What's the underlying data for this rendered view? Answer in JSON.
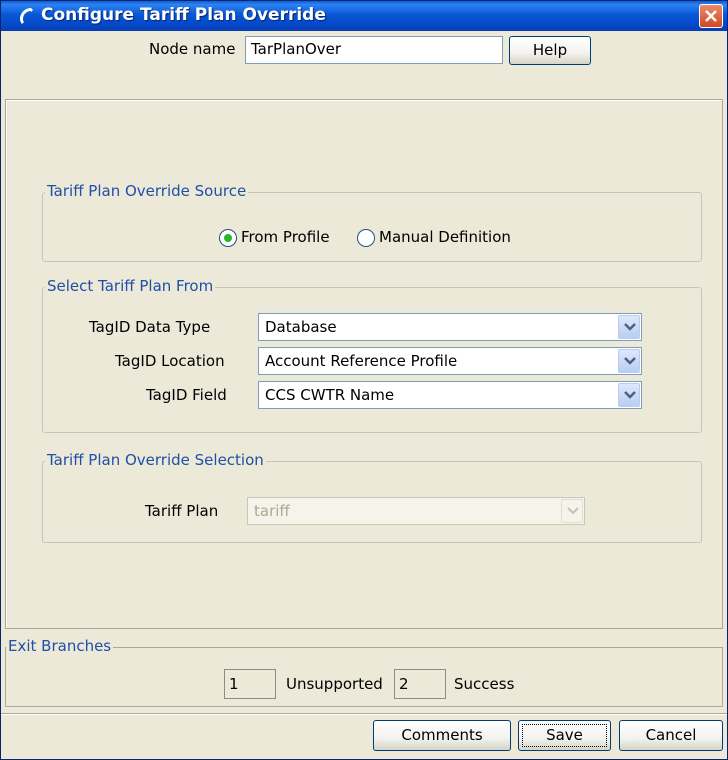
{
  "window": {
    "title": "Configure Tariff Plan Override"
  },
  "node": {
    "label": "Node name",
    "value": "TarPlanOver",
    "help_label": "Help"
  },
  "source_group": {
    "legend": "Tariff Plan Override Source",
    "options": [
      {
        "label": "From Profile",
        "selected": true
      },
      {
        "label": "Manual Definition",
        "selected": false
      }
    ]
  },
  "select_group": {
    "legend": "Select Tariff Plan From",
    "fields": [
      {
        "label": "TagID Data Type",
        "value": "Database"
      },
      {
        "label": "TagID Location",
        "value": "Account Reference Profile"
      },
      {
        "label": "TagID Field",
        "value": "CCS CWTR Name"
      }
    ]
  },
  "selection_group": {
    "legend": "Tariff Plan Override Selection",
    "label": "Tariff Plan",
    "value": "tariff",
    "enabled": false
  },
  "exit_branches": {
    "legend": "Exit Branches",
    "branches": [
      {
        "number": "1",
        "name": "Unsupported"
      },
      {
        "number": "2",
        "name": "Success"
      }
    ]
  },
  "footer": {
    "comments_label": "Comments",
    "save_label": "Save",
    "cancel_label": "Cancel"
  },
  "colors": {
    "title_bar": "#0858d6",
    "legend_text": "#1f4fa6",
    "close_button": "#d4461f",
    "radio_selected": "#28b828"
  },
  "icons": {
    "app": "phone-handset-icon",
    "close": "close-icon",
    "dropdown": "chevron-down-icon"
  }
}
